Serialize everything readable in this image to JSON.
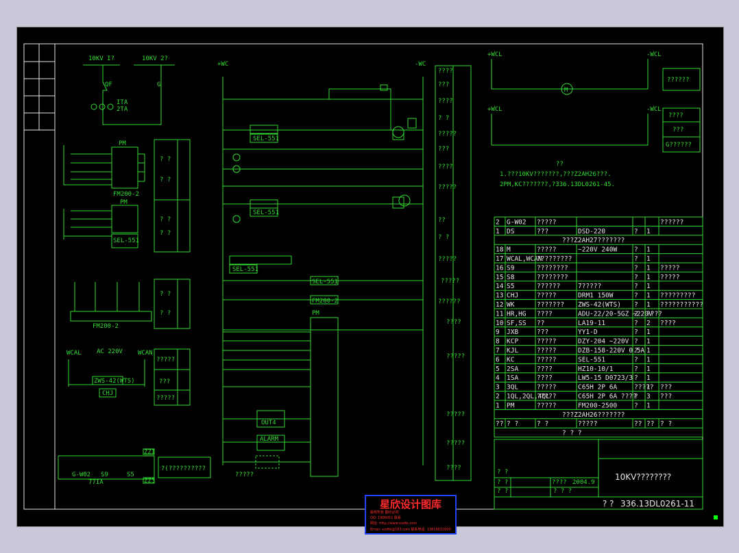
{
  "title_block": {
    "drawing_title": "10KV????????",
    "drawing_number": "336.13DL0261-11",
    "date": "2004.9",
    "role_1": "? ?",
    "role_2": "????",
    "role_3": "? ?",
    "cell_a": "? ? ?",
    "cell_b": "? ?",
    "cell_c": "? ?"
  },
  "notes": {
    "heading": "??",
    "line1": "1.???10KV???????,???Z2AH26???.",
    "line2": "2PM,KC???????,?336.13DL0261-45."
  },
  "bus": {
    "bus1": "10KV  I?",
    "bus2": "10KV  2?",
    "qf": "QF",
    "g": "G",
    "ta": "ITA",
    "ta2": "2TA"
  },
  "power_labels": {
    "pos": "+WC",
    "neg": "-WC",
    "wcl_pos": "+WCL",
    "wcl_neg": "-WCL",
    "ac": "AC 220V",
    "wcal": "WCAL",
    "wcan": "WCAN"
  },
  "relays": {
    "sel1": "SEL-551",
    "sel2": "SEL-551",
    "sel3": "SEL-551",
    "sel4": "SEL-551",
    "fm1": "FM200-2",
    "fm2": "FM200-2",
    "fm3": "FM200-2",
    "chj": "CHJ",
    "zws": "ZWS-42(WTS)",
    "out3": "OUT3",
    "out4": "OUT4",
    "alarm": "ALARM",
    "pm": "PM"
  },
  "right_strip": [
    "????",
    "???",
    "????",
    "? ?",
    "?????",
    "???",
    "????",
    "?????",
    "? ?",
    "??",
    "?????",
    "?????",
    "??????",
    "????",
    "?????",
    "?????",
    "?????",
    "????"
  ],
  "left_tables": [
    "? ?",
    "? ?",
    "? ?",
    "? ?",
    "?????",
    "???",
    "?????"
  ],
  "bottom_box": "?(??????????",
  "bottom_left": {
    "gw": "G-W02",
    "s9": "S9",
    "s5": "S5",
    "z1": "ZZI",
    "z3": "ZZ3",
    "ta": "77IA"
  },
  "right_boxes": [
    "??????",
    "????",
    "???",
    "G??????"
  ],
  "parts_list": {
    "top_row": [
      "2",
      "G-W02",
      "?????",
      "",
      "",
      "",
      "??????"
    ],
    "row1": [
      "1",
      "DS",
      "???",
      "DSD-220",
      "?",
      "1",
      ""
    ],
    "caption_top": "???Z2AH27???????",
    "rows": [
      [
        "18",
        "M",
        "?????",
        "~220V 240W",
        "?",
        "1",
        ""
      ],
      [
        "17",
        "WCAL,WCAN",
        "?????????",
        "",
        "?",
        "1",
        ""
      ],
      [
        "16",
        "S9",
        "????????",
        "",
        "?",
        "1",
        "?????"
      ],
      [
        "15",
        "S8",
        "????????",
        "",
        "?",
        "1",
        "?????"
      ],
      [
        "14",
        "S5",
        "??????",
        "7?????",
        "?",
        "1",
        ""
      ],
      [
        "13",
        "CHJ",
        "?????",
        "DRM1 150W",
        "?",
        "1",
        "?????????"
      ],
      [
        "12",
        "WK",
        "???????",
        "ZWS-42(WTS)",
        "?",
        "1",
        "???????????"
      ],
      [
        "11",
        "HR,HG",
        "????",
        "ADU-22/20-5GZ ~220V",
        "2",
        "????",
        ""
      ],
      [
        "10",
        "SF,SS",
        "??",
        "LA19-11",
        "?",
        "2",
        "????"
      ],
      [
        "9",
        "JXB",
        "???",
        "YY1-D",
        "?",
        "1",
        ""
      ],
      [
        "8",
        "KCP",
        "?????",
        "DZY-204 ~220V",
        "?",
        "1",
        ""
      ],
      [
        "7",
        "KJL",
        "?????",
        "DZB-158-220V 0.5A",
        "?",
        "1",
        ""
      ],
      [
        "6",
        "KC",
        "?????",
        "SEL-551",
        "?",
        "1",
        ""
      ],
      [
        "5",
        "2SA",
        "????",
        "HZ10-10/1",
        "?",
        "1",
        ""
      ],
      [
        "4",
        "1SA",
        "????",
        "LW5-15 D0723/3",
        "?",
        "1",
        ""
      ],
      [
        "3",
        "3QL",
        "?????",
        "C65H 2P 6A",
        "?????",
        "1",
        "???"
      ],
      [
        "2",
        "1QL,2QL,4QL",
        "?????",
        "C65H 2P 6A ????",
        "?",
        "3",
        "???"
      ],
      [
        "1",
        "PM",
        "?????",
        "FM200-2500",
        "?",
        "1",
        ""
      ]
    ],
    "caption_bottom": "???Z2AH26???????",
    "header": [
      "??",
      "? ?",
      "? ?",
      "?????",
      "??",
      "??",
      "? ?"
    ],
    "header_title": "? ? ?"
  },
  "stamp": {
    "title": "星欣设计图库",
    "line1": "版权所有 翻印必究",
    "line2": "QQ: 1906051 联系",
    "line3": "网址: http://www.xxdtk.com",
    "line4": "Email: xxdtk@163.com 联系电话: 13819012000"
  }
}
